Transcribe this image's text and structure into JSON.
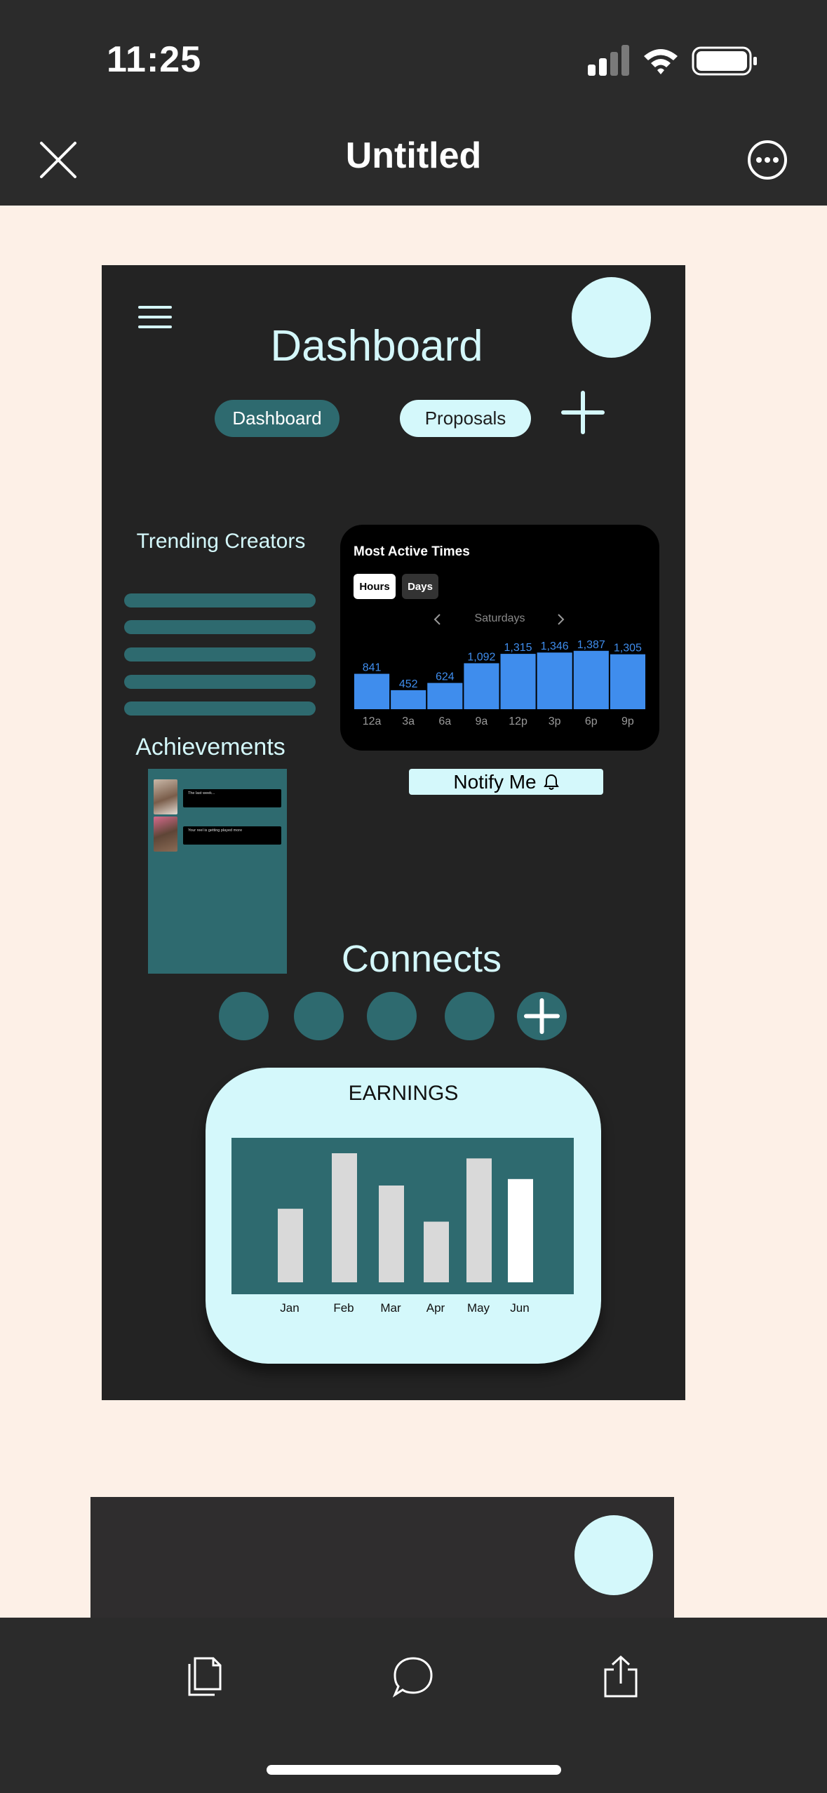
{
  "status_bar": {
    "time": "11:25"
  },
  "nav": {
    "title": "Untitled"
  },
  "dashboard": {
    "title": "Dashboard",
    "pills": {
      "dashboard": "Dashboard",
      "proposals": "Proposals"
    },
    "trending_title": "Trending Creators",
    "achievements_title": "Achievements",
    "achievements": [
      {
        "text": "The last week..."
      },
      {
        "text": "Your reel is getting played more"
      }
    ],
    "connects_title": "Connects",
    "notify_label": "Notify Me"
  },
  "active_times": {
    "title": "Most Active Times",
    "tabs": [
      "Hours",
      "Days"
    ],
    "day": "Saturdays"
  },
  "earnings": {
    "title": "EARNINGS"
  },
  "colors": {
    "teal": "#2e6a6f",
    "mint": "#d4f8fb",
    "bar_blue": "#3f8ded"
  },
  "chart_data": [
    {
      "type": "bar",
      "title": "Most Active Times",
      "categories": [
        "12a",
        "3a",
        "6a",
        "9a",
        "12p",
        "3p",
        "6p",
        "9p"
      ],
      "values": [
        841,
        452,
        624,
        1092,
        1315,
        1346,
        1387,
        1305
      ],
      "ylim": [
        0,
        1500
      ]
    },
    {
      "type": "bar",
      "title": "EARNINGS",
      "categories": [
        "Jan",
        "Feb",
        "Mar",
        "Apr",
        "May",
        "Jun"
      ],
      "values": [
        57,
        100,
        75,
        47,
        96,
        80
      ],
      "ylim": [
        0,
        100
      ]
    }
  ]
}
